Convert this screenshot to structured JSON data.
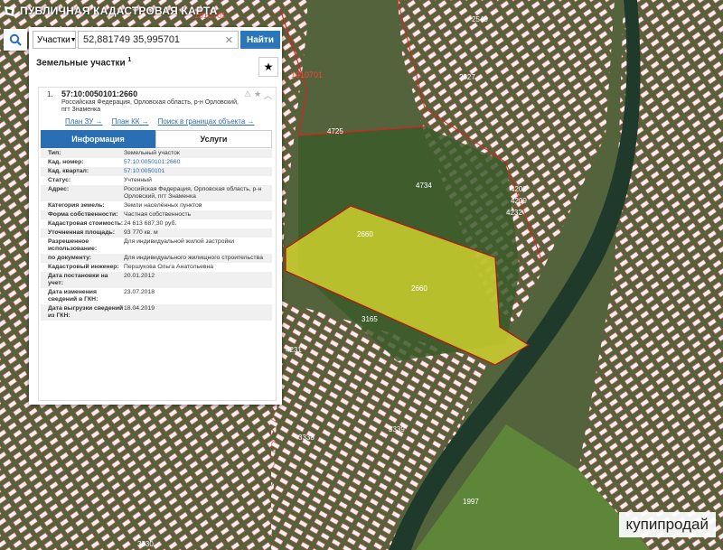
{
  "header": {
    "title": "ПУБЛИЧНАЯ КАДАСТРОВАЯ КАРТА"
  },
  "search": {
    "type_label": "Участки",
    "query": "52,881749 35,995701",
    "find_label": "Найти"
  },
  "section": {
    "title": "Земельные участки",
    "count": "1"
  },
  "parcel": {
    "index": "1.",
    "number": "57:10:0050101:2660",
    "address": "Российская Федерация, Орловская область, р-н Орловский, пгт Знаменка",
    "links": [
      "План ЗУ →",
      "План КК →",
      "Поиск в границах объекта →"
    ]
  },
  "tabs": [
    "Информация",
    "Услуги"
  ],
  "info_rows": [
    {
      "k": "Тип:",
      "v": "Земельный участок"
    },
    {
      "k": "Кад. номер:",
      "v": "57:10:0050101:2660"
    },
    {
      "k": "Кад. квартал:",
      "v": "57:10:0050101"
    },
    {
      "k": "Статус:",
      "v": "Учтенный"
    },
    {
      "k": "Адрес:",
      "v": "Российская Федерация, Орловская область, р-н Орловский, пгт Знаменка"
    },
    {
      "k": "Категория земель:",
      "v": "Земли населённых пунктов"
    },
    {
      "k": "Форма собственности:",
      "v": "Частная собственность"
    },
    {
      "k": "Кадастровая стоимость:",
      "v": "24 613 687,30 руб."
    },
    {
      "k": "Уточненная площадь:",
      "v": "93 770 кв. м"
    },
    {
      "k": "Разрешенное использование:",
      "v": "Для индивидуальной жилой застройки"
    },
    {
      "k": "по документу:",
      "v": "Для индивидуального жилищного строительства"
    },
    {
      "k": "Кадастровый инженер:",
      "v": "Першукова Ольга Анатольевна"
    },
    {
      "k": "Дата постановки на учет:",
      "v": "20.01.2012"
    },
    {
      "k": "Дата изменения сведений в ГКН:",
      "v": "23.07.2018"
    },
    {
      "k": "Дата выгрузки сведений из ГКН:",
      "v": "18.04.2019"
    }
  ],
  "map_labels": [
    "1910701",
    "1910701",
    "2660",
    "2660",
    "4725",
    "4734",
    "1997",
    "3339",
    "3338",
    "3330",
    "3165",
    "4231",
    "4232",
    "4208",
    "4209",
    "2540",
    "2827"
  ],
  "watermark": "купипродай",
  "colors": {
    "accent": "#2a6fb4",
    "parcel_fill": "#e2e02e",
    "parcel_border": "#e02020",
    "river": "#1f3a2a"
  }
}
